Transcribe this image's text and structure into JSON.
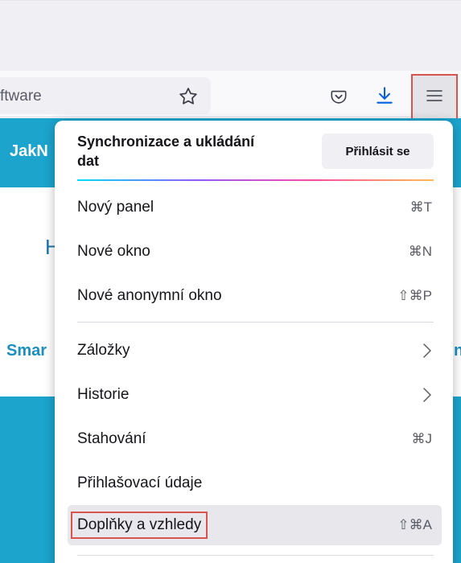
{
  "toolbar": {
    "url_text": "ftware"
  },
  "page": {
    "header_text": "JakN",
    "h_letter": "H",
    "nav_left": "Smar",
    "nav_right": "n"
  },
  "menu": {
    "sync_title": "Synchronizace a ukládání dat",
    "signin_label": "Přihlásit se",
    "items": [
      {
        "label": "Nový panel",
        "shortcut": "⌘T"
      },
      {
        "label": "Nové okno",
        "shortcut": "⌘N"
      },
      {
        "label": "Nové anonymní okno",
        "shortcut": "⇧⌘P"
      },
      {
        "label": "Záložky",
        "shortcut": ""
      },
      {
        "label": "Historie",
        "shortcut": ""
      },
      {
        "label": "Stahování",
        "shortcut": "⌘J"
      },
      {
        "label": "Přihlašovací údaje",
        "shortcut": ""
      },
      {
        "label": "Doplňky a vzhledy",
        "shortcut": "⇧⌘A"
      }
    ]
  },
  "icons": {
    "star": "star-icon",
    "pocket": "pocket-icon",
    "download": "download-icon",
    "menu": "hamburger-menu-icon"
  },
  "colors": {
    "accent": "#1ca4cd",
    "highlight_outline": "#d9534f",
    "download_blue": "#0060df"
  }
}
